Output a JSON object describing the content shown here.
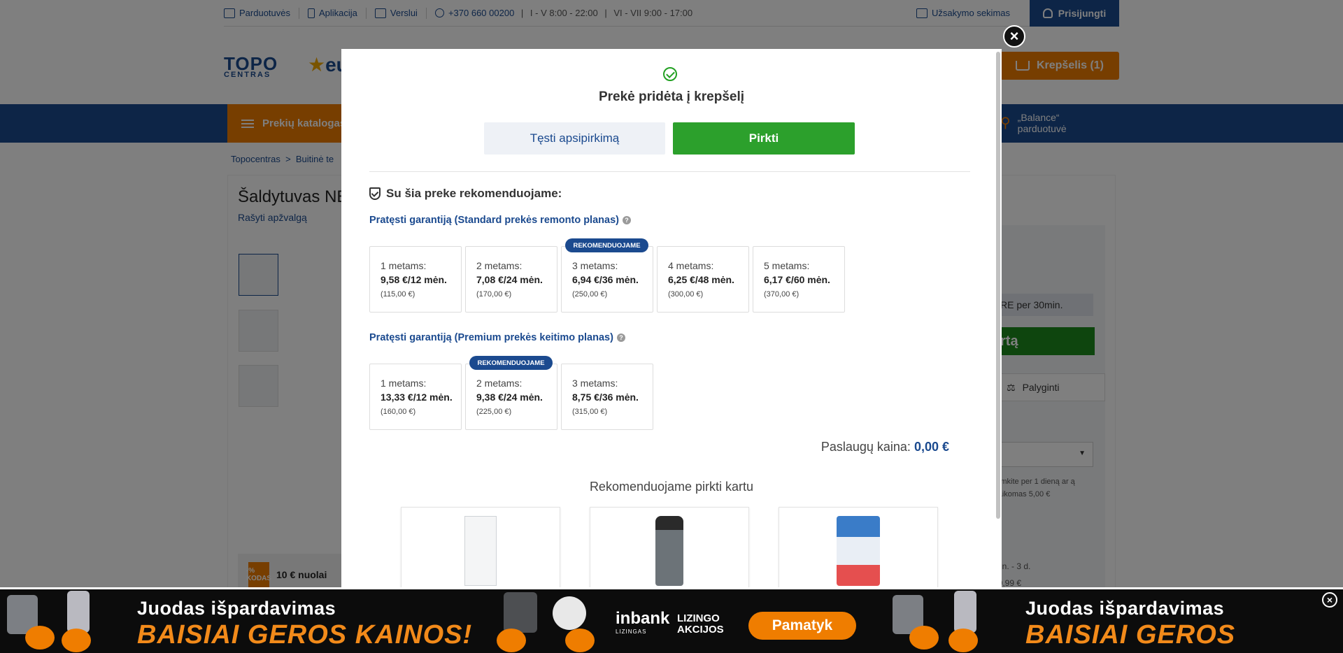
{
  "topbar": {
    "stores": "Parduotuvės",
    "app": "Aplikacija",
    "business": "Verslui",
    "phone": "+370 660 00200",
    "hours_weekday": "I - V 8:00 - 22:00",
    "hours_weekend": "VI - VII 9:00 - 17:00",
    "order_tracking": "Užsakymo sekimas",
    "login": "Prisijungti"
  },
  "header": {
    "logo_main": "TOPO",
    "logo_sub": "CENTRAS",
    "logo_partner": "eu",
    "cart_label": "Krepšelis (1)"
  },
  "nav": {
    "catalog": "Prekių katalogas",
    "balance_line1": "„Balance“",
    "balance_line2": "parduotuvė"
  },
  "background_page": {
    "breadcrumb_home": "Topocentras",
    "breadcrumb_sep": ">",
    "breadcrumb_cat": "Buitinė te",
    "product_title": "Šaldytuvas NE",
    "review_link": "Rašyti apžvalgą",
    "timer_text": "RE per 30min.",
    "buy_button_fragment": "rtą",
    "compare": "Palyginti",
    "delivery_text": "siimkite per 1 dieną ar ą (taikomas 5,00 €",
    "delivery_time": "min. - 3 d.",
    "delivery_price": "20,99 €",
    "promo_badge": "-% KODAS",
    "promo_text": "10 € nuolai"
  },
  "modal": {
    "title": "Prekė pridėta į krepšelį",
    "continue_button": "Tęsti apsipirkimą",
    "buy_button": "Pirkti",
    "recommend_heading": "Su šia preke rekomenduojame:",
    "standard_title": "Pratęsti garantiją (Standard prekės remonto planas)",
    "standard_plans": [
      {
        "term": "1 metams:",
        "monthly": "9,58 €/12 mėn.",
        "total": "(115,00 €)",
        "badge": ""
      },
      {
        "term": "2 metams:",
        "monthly": "7,08 €/24 mėn.",
        "total": "(170,00 €)",
        "badge": ""
      },
      {
        "term": "3 metams:",
        "monthly": "6,94 €/36 mėn.",
        "total": "(250,00 €)",
        "badge": "REKOMENDUOJAME"
      },
      {
        "term": "4 metams:",
        "monthly": "6,25 €/48 mėn.",
        "total": "(300,00 €)",
        "badge": ""
      },
      {
        "term": "5 metams:",
        "monthly": "6,17 €/60 mėn.",
        "total": "(370,00 €)",
        "badge": ""
      }
    ],
    "premium_title": "Pratęsti garantiją (Premium prekės keitimo planas)",
    "premium_plans": [
      {
        "term": "1 metams:",
        "monthly": "13,33 €/12 mėn.",
        "total": "(160,00 €)",
        "badge": ""
      },
      {
        "term": "2 metams:",
        "monthly": "9,38 €/24 mėn.",
        "total": "(225,00 €)",
        "badge": "REKOMENDUOJAME"
      },
      {
        "term": "3 metams:",
        "monthly": "8,75 €/36 mėn.",
        "total": "(315,00 €)",
        "badge": ""
      }
    ],
    "service_price_label": "Paslaugų kaina:",
    "service_price_value": "0,00 €",
    "buy_together_title": "Rekomenduojame pirkti kartu",
    "close_icon": "close-icon"
  },
  "banner": {
    "heading": "Juodas išpardavimas",
    "subheading": "BAISIAI GEROS KAINOS!",
    "partner": "inbank",
    "partner_sub": "LIZINGAS",
    "leasing_line1": "LIZINGO",
    "leasing_line2": "AKCIJOS",
    "cta": "Pamatyk"
  },
  "colors": {
    "brand_blue": "#1b4a8f",
    "brand_orange": "#ef7d00",
    "buy_green": "#2ca02c"
  }
}
